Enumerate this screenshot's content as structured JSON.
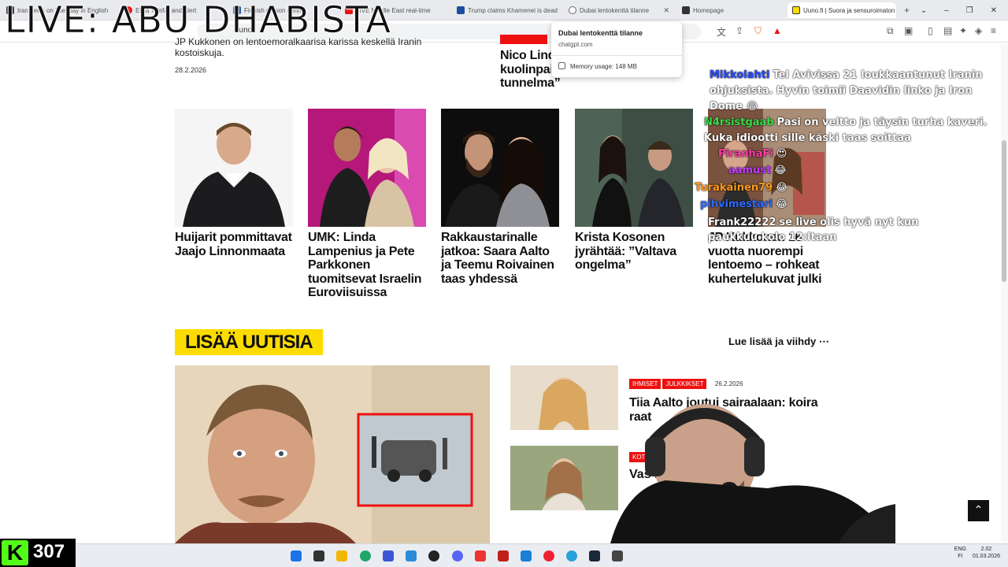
{
  "overlay": {
    "title": "LIVE: ABU DHABISTA",
    "viewer_count": "307",
    "brand_letter": "K"
  },
  "browser": {
    "tabs": [
      {
        "label": "Iran news on Tuesday in English",
        "color": "#222"
      },
      {
        "label": "Elisa Telefar and Alert",
        "color": "#e11"
      },
      {
        "label": "Finnish person dennis",
        "color": "#1d4ea0"
      },
      {
        "label": "LIVE Middle East real-time",
        "color": "#e11"
      },
      {
        "label": "Trump claims Khamenei is dead",
        "color": "#1d4ea0"
      },
      {
        "label": "Dubai lentokenttä tilanne",
        "color": "#666"
      },
      {
        "label": "Homepage",
        "color": "#333"
      },
      {
        "label": "Uuno.fi | Suora ja sensuroimaton",
        "color": "#fcdc00"
      }
    ],
    "new_tab": "+",
    "omnibox_text": "uuno",
    "tooltip": {
      "title": "Dubai lentokenttä tilanne",
      "domain": "chatgpt.com",
      "memory": "Memory usage: 148 MB"
    }
  },
  "page": {
    "top_left_text": "JP Kukkonen on lentoemoralkaarisa karissa keskellä Iranin kostoiskuja.",
    "top_left_date": "28.2.2026",
    "top_right_headline": "Nico Lindberg pikkuveljen kuolinpaikalle – ”pysäyttävä tunnelma”",
    "cards": [
      {
        "headline": "Huijarit pommittavat Jaajo Linnonmaata"
      },
      {
        "headline": "UMK: Linda Lampenius ja Pete Parkkonen tuomitsevat Israelin Euroviisuissa"
      },
      {
        "headline": "Rakkaustarinalle jatkoa: Saara Aalto ja Teemu Roivainen taas yhdessä"
      },
      {
        "headline": "Krista Kosonen jyrähtää: ”Valtava ongelma”"
      },
      {
        "headline": "JP Kukkonen 16 vuotta nuorempi lentoemo – rohkeat kuhertelukuvat julki"
      }
    ],
    "section_title": "LISÄÄ UUTISIA",
    "read_more": "Lue lisää ja viihdy ⋯",
    "list": [
      {
        "badges": [
          "IHMISET",
          "JULKKIKSET"
        ],
        "date": "26.2.2026",
        "headline": "Tiia Aalto joutui sairaalaan: koira raat"
      },
      {
        "badges": [
          "KOT"
        ],
        "date": "",
        "headline": "Vas ka"
      }
    ],
    "scroll_top_icon": "⌃"
  },
  "chat": [
    {
      "user": "Mikkolahti",
      "color": "#2b4cff",
      "message": "Tel Avivissa 21 loukkaantunut Iranin ohjuksista. Hyvin toimii Daavidin linko ja Iron Dome 😂"
    },
    {
      "user": "N4rsistgaab",
      "color": "#3ddc4c",
      "message": "Pasi on veltto ja täysin turha kaveri. Kuka idiootti sille käski taas soittaa"
    },
    {
      "user": "PiranhaFi",
      "color": "#ff3ba5",
      "message": "😍"
    },
    {
      "user": "aamust",
      "color": "#c13cff",
      "message": "😂"
    },
    {
      "user": "Turakainen79",
      "color": "#ff9a1f",
      "message": "😂"
    },
    {
      "user": "pihvimestari",
      "color": "#2e6bff",
      "message": "😂"
    },
    {
      "user": "Frank22222",
      "color": "#ffffff",
      "message": "se live olis hyvä nyt kun paukkuu kolo 12:ltaan"
    }
  ],
  "taskbar": {
    "lang": "ENG",
    "region": "FI",
    "time": "2.02",
    "date": "01.03.2026"
  },
  "colors": {
    "accent_yellow": "#fcdc00",
    "badge_red": "#e11111",
    "kick_green": "#53fc18"
  }
}
